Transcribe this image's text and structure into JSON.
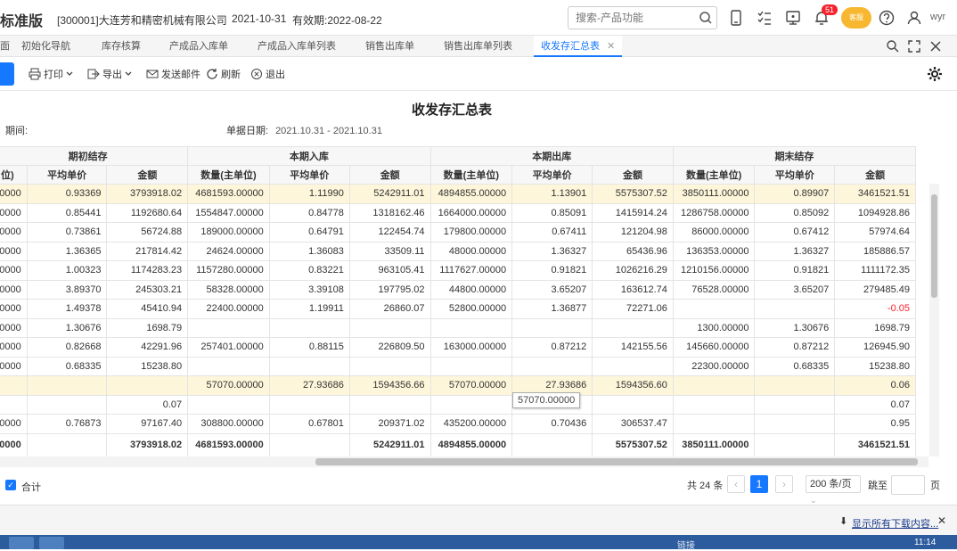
{
  "header": {
    "brand": "标准版",
    "company": "[300001]大连芳和精密机械有限公司",
    "date": "2021-10-31",
    "valid": "有效期:2022-08-22",
    "search_placeholder": "搜索-产品功能",
    "notification_count": "51",
    "avatar_text": "客服",
    "user": "wyr"
  },
  "tabs": [
    {
      "label": "面"
    },
    {
      "label": "初始化导航"
    },
    {
      "label": "库存核算"
    },
    {
      "label": "产成品入库单"
    },
    {
      "label": "产成品入库单列表"
    },
    {
      "label": "销售出库单"
    },
    {
      "label": "销售出库单列表"
    },
    {
      "label": "收发存汇总表",
      "active": true
    }
  ],
  "toolbar": {
    "print": "打印",
    "export": "导出",
    "email": "发送邮件",
    "refresh": "刷新",
    "exit": "退出"
  },
  "report": {
    "title": "收发存汇总表",
    "period_label": "期间:",
    "bill_date_label": "单据日期:",
    "bill_date_value": "2021.10.31 - 2021.10.31"
  },
  "table": {
    "groups": [
      "期初结存",
      "本期入库",
      "本期出库",
      "期末结存"
    ],
    "columns": [
      "位)",
      "平均单价",
      "金额",
      "数量(主单位)",
      "平均单价",
      "金额",
      "数量(主单位)",
      "平均单价",
      "金额",
      "数量(主单位)",
      "平均单价",
      "金额"
    ],
    "rows": [
      [
        "00000",
        "0.93369",
        "3793918.02",
        "4681593.00000",
        "1.11990",
        "5242911.01",
        "4894855.00000",
        "1.13901",
        "5575307.52",
        "3850111.00000",
        "0.89907",
        "3461521.51"
      ],
      [
        "00000",
        "0.85441",
        "1192680.64",
        "1554847.00000",
        "0.84778",
        "1318162.46",
        "1664000.00000",
        "0.85091",
        "1415914.24",
        "1286758.00000",
        "0.85092",
        "1094928.86"
      ],
      [
        "00000",
        "0.73861",
        "56724.88",
        "189000.00000",
        "0.64791",
        "122454.74",
        "179800.00000",
        "0.67411",
        "121204.98",
        "86000.00000",
        "0.67412",
        "57974.64"
      ],
      [
        "00000",
        "1.36365",
        "217814.42",
        "24624.00000",
        "1.36083",
        "33509.11",
        "48000.00000",
        "1.36327",
        "65436.96",
        "136353.00000",
        "1.36327",
        "185886.57"
      ],
      [
        "00000",
        "1.00323",
        "1174283.23",
        "1157280.00000",
        "0.83221",
        "963105.41",
        "1117627.00000",
        "0.91821",
        "1026216.29",
        "1210156.00000",
        "0.91821",
        "1111172.35"
      ],
      [
        "00000",
        "3.89370",
        "245303.21",
        "58328.00000",
        "3.39108",
        "197795.02",
        "44800.00000",
        "3.65207",
        "163612.74",
        "76528.00000",
        "3.65207",
        "279485.49"
      ],
      [
        "00000",
        "1.49378",
        "45410.94",
        "22400.00000",
        "1.19911",
        "26860.07",
        "52800.00000",
        "1.36877",
        "72271.06",
        "",
        "",
        "-0.05"
      ],
      [
        "00000",
        "1.30676",
        "1698.79",
        "",
        "",
        "",
        "",
        "",
        "",
        "1300.00000",
        "1.30676",
        "1698.79"
      ],
      [
        "00000",
        "0.82668",
        "42291.96",
        "257401.00000",
        "0.88115",
        "226809.50",
        "163000.00000",
        "0.87212",
        "142155.56",
        "145660.00000",
        "0.87212",
        "126945.90"
      ],
      [
        "00000",
        "0.68335",
        "15238.80",
        "",
        "",
        "",
        "",
        "",
        "",
        "22300.00000",
        "0.68335",
        "15238.80"
      ],
      [
        "",
        "",
        "",
        "57070.00000",
        "27.93686",
        "1594356.66",
        "57070.00000",
        "27.93686",
        "1594356.60",
        "",
        "",
        "0.06"
      ],
      [
        "",
        "",
        "0.07",
        "",
        "",
        "",
        "",
        "",
        "",
        "",
        "",
        "0.07"
      ],
      [
        "00000",
        "0.76873",
        "97167.40",
        "308800.00000",
        "0.67801",
        "209371.02",
        "435200.00000",
        "0.70436",
        "306537.47",
        "",
        "",
        "0.95"
      ]
    ],
    "total": [
      "00000",
      "",
      "3793918.02",
      "4681593.00000",
      "",
      "5242911.01",
      "4894855.00000",
      "",
      "5575307.52",
      "3850111.00000",
      "",
      "3461521.51"
    ],
    "tooltip": "57070.00000"
  },
  "footer": {
    "sum_label": "合计",
    "total_count": "共 24 条",
    "current_page": "1",
    "page_size": "200 条/页",
    "jump_label": "跳至",
    "page_unit": "页"
  },
  "download_bar": {
    "text": "显示所有下载内容...",
    "close": "✕"
  },
  "taskbar": {
    "tray_text": "链接",
    "clock": "11:14"
  },
  "colors": {
    "accent": "#1677ff",
    "highlight_row": "#fdf6da",
    "negative": "#f5222d"
  }
}
